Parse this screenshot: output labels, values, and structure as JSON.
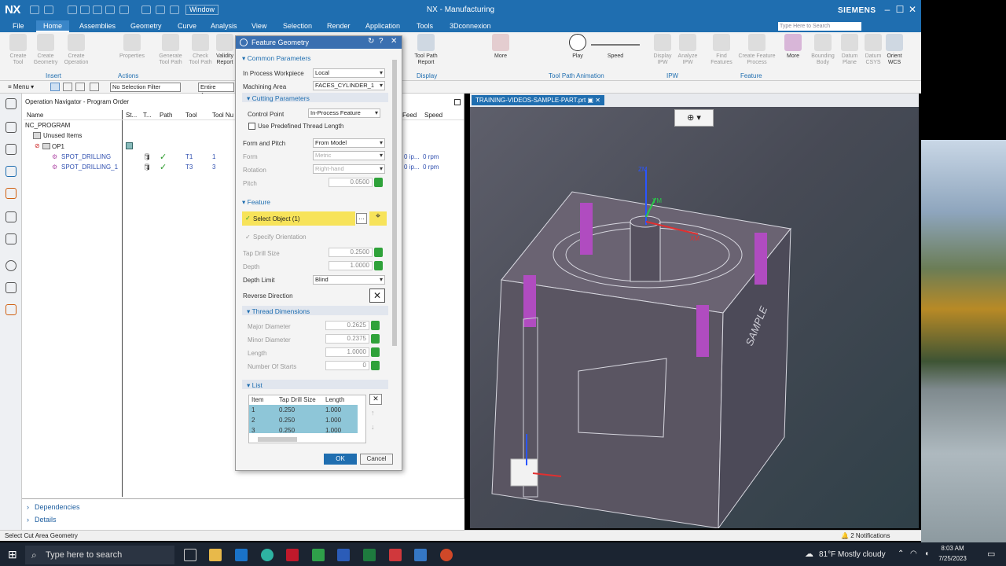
{
  "app": {
    "logo": "NX",
    "window_menu": "Window",
    "title": "NX - Manufacturing",
    "brand": "SIEMENS",
    "search_placeholder": "Type Here to Search"
  },
  "menus": [
    "File",
    "Home",
    "Assemblies",
    "Geometry",
    "Curve",
    "Analysis",
    "View",
    "Selection",
    "Render",
    "Application",
    "Tools",
    "3Dconnexion"
  ],
  "ribbon": {
    "left_buttons": [
      "Create Tool",
      "Create Geometry",
      "Create Operation",
      "Properties",
      "Generate Tool Path",
      "Check Tool Path",
      "Validity Report"
    ],
    "right_buttons": [
      "Tool Path Report",
      "More",
      "Play",
      "Speed",
      "Display IPW",
      "Analyze IPW",
      "Find Features",
      "Create Feature Process",
      "More",
      "Bounding Body",
      "Datum Plane",
      "Datum CSYS",
      "Orient WCS"
    ],
    "groups": [
      "Insert",
      "Actions",
      "Display",
      "Tool Path Animation",
      "IPW",
      "Feature"
    ]
  },
  "toolbar": {
    "menu": "Menu",
    "filter": "No Selection Filter",
    "scope": "Entire Assem"
  },
  "navigator": {
    "title": "Operation Navigator - Program Order",
    "columns": [
      "Name",
      "St...",
      "T...",
      "Path",
      "Tool",
      "Tool Nu",
      "Feed",
      "Speed"
    ],
    "rows": [
      {
        "name": "NC_PROGRAM",
        "tool": "",
        "num": "",
        "feed": "",
        "speed": ""
      },
      {
        "name": "Unused Items",
        "tool": "",
        "num": "",
        "feed": "",
        "speed": ""
      },
      {
        "name": "OP1",
        "tool": "",
        "num": "",
        "feed": "",
        "speed": ""
      },
      {
        "name": "SPOT_DRILLING",
        "tool": "T1",
        "num": "1",
        "feed": "0 ip...",
        "speed": "0 rpm"
      },
      {
        "name": "SPOT_DRILLING_1",
        "tool": "T3",
        "num": "3",
        "feed": "0 ip...",
        "speed": "0 rpm"
      }
    ],
    "bottom": [
      "Dependencies",
      "Details"
    ]
  },
  "viewport": {
    "tab": "TRAINING-VIDEOS-SAMPLE-PART.prt",
    "axis_z": "ZM",
    "axis_y": "YM",
    "axis_x": "XM",
    "label_sample": "SAMPLE"
  },
  "dialog": {
    "title": "Feature Geometry",
    "common": "Common Parameters",
    "in_process_workpiece_label": "In Process Workpiece",
    "in_process_workpiece": "Local",
    "machining_area_label": "Machining Area",
    "machining_area": "FACES_CYLINDER_1",
    "cutting": "Cutting Parameters",
    "control_point_label": "Control Point",
    "control_point": "In-Process Feature",
    "use_thread": "Use Predefined Thread Length",
    "form_pitch_label": "Form and Pitch",
    "form_pitch": "From Model",
    "form_label": "Form",
    "form": "Metric",
    "rotation_label": "Rotation",
    "rotation": "Right-hand",
    "pitch_label": "Pitch",
    "pitch": "0.0500",
    "feature": "Feature",
    "select_object": "Select Object (1)",
    "specify_orientation": "Specify Orientation",
    "tap_drill_label": "Tap Drill Size",
    "tap_drill": "0.2500",
    "depth_label": "Depth",
    "depth": "1.0000",
    "depth_limit_label": "Depth Limit",
    "depth_limit": "Blind",
    "reverse_label": "Reverse Direction",
    "thread_dims": "Thread Dimensions",
    "major_label": "Major Diameter",
    "major": "0.2625",
    "minor_label": "Minor Diameter",
    "minor": "0.2375",
    "length_label": "Length",
    "length": "1.0000",
    "starts_label": "Number Of Starts",
    "starts": "0",
    "list": "List",
    "list_cols": [
      "Item",
      "Tap Drill Size",
      "Length"
    ],
    "list_rows": [
      [
        "1",
        "0.250",
        "1.000"
      ],
      [
        "2",
        "0.250",
        "1.000"
      ],
      [
        "3",
        "0.250",
        "1.000"
      ]
    ],
    "ok": "OK",
    "cancel": "Cancel"
  },
  "status": {
    "left": "Select Cut Area Geometry",
    "notifications": "2 Notifications"
  },
  "taskbar": {
    "search": "Type here to search",
    "weather": "81°F  Mostly cloudy",
    "time": "8:03 AM",
    "date": "7/25/2023"
  },
  "colors": {
    "accent": "#1f6eb0",
    "highlight": "#f7e35a",
    "list_sel": "#8ec6d8",
    "hole": "#b04cc0"
  }
}
